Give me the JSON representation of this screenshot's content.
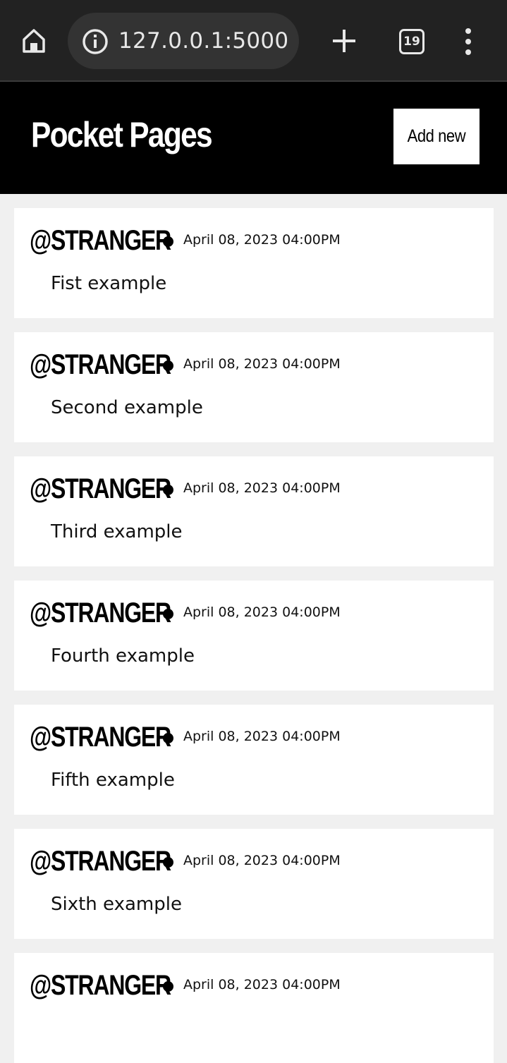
{
  "browser": {
    "url": "127.0.0.1:5000",
    "tab_count": "19"
  },
  "header": {
    "title": "Pocket Pages",
    "add_button_label": "Add new"
  },
  "posts": [
    {
      "author": "@STRANGER",
      "date": "April 08, 2023 04:00PM",
      "body": "Fist example"
    },
    {
      "author": "@STRANGER",
      "date": "April 08, 2023 04:00PM",
      "body": "Second example"
    },
    {
      "author": "@STRANGER",
      "date": "April 08, 2023 04:00PM",
      "body": "Third example"
    },
    {
      "author": "@STRANGER",
      "date": "April 08, 2023 04:00PM",
      "body": "Fourth example"
    },
    {
      "author": "@STRANGER",
      "date": "April 08, 2023 04:00PM",
      "body": "Fifth example"
    },
    {
      "author": "@STRANGER",
      "date": "April 08, 2023 04:00PM",
      "body": "Sixth example"
    },
    {
      "author": "@STRANGER",
      "date": "April 08, 2023 04:00PM",
      "body": ""
    }
  ],
  "icons": {
    "home": "home-icon",
    "info": "info-icon",
    "new_tab": "plus-icon",
    "tabs": "tabs-icon",
    "menu": "more-vert-icon"
  },
  "colors": {
    "browser_bar": "#222222",
    "header_bg": "#000000",
    "page_bg": "#f0f0f0",
    "card_bg": "#ffffff"
  }
}
